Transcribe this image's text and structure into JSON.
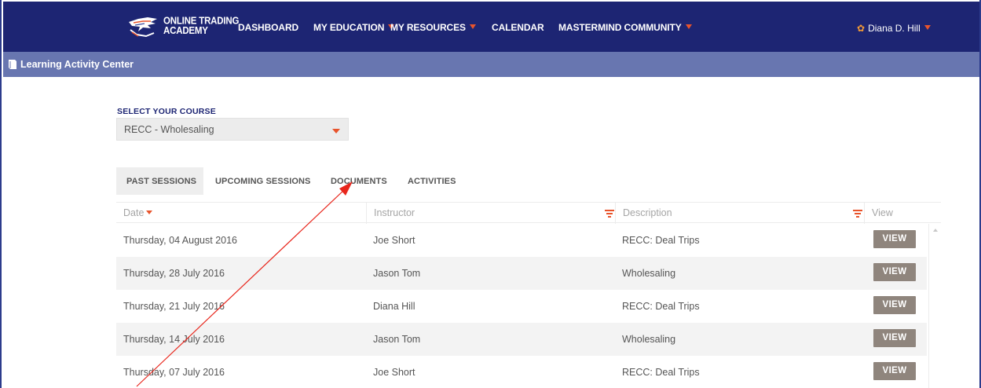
{
  "colors": {
    "nav_bg": "#1d2573",
    "subbar_bg": "#6876b0",
    "accent": "#e8542c",
    "button_bg": "#8f857d"
  },
  "logo": {
    "line1": "ONLINE TRADING",
    "line2": "ACADEMY"
  },
  "nav": {
    "items": [
      {
        "label": "DASHBOARD",
        "has_dropdown": false
      },
      {
        "label": "MY EDUCATION",
        "has_dropdown": true
      },
      {
        "label": "MY RESOURCES",
        "has_dropdown": true
      },
      {
        "label": "CALENDAR",
        "has_dropdown": false
      },
      {
        "label": "MASTERMIND COMMUNITY",
        "has_dropdown": true
      }
    ],
    "user_name": "Diana D. Hill"
  },
  "subheader": {
    "title": "Learning Activity Center",
    "icon": "book-icon"
  },
  "course": {
    "label": "SELECT YOUR COURSE",
    "selected": "RECC - Wholesaling"
  },
  "tabs": [
    {
      "label": "PAST SESSIONS",
      "active": true
    },
    {
      "label": "UPCOMING SESSIONS",
      "active": false
    },
    {
      "label": "DOCUMENTS",
      "active": false
    },
    {
      "label": "ACTIVITIES",
      "active": false
    }
  ],
  "table": {
    "columns": [
      "Date",
      "Instructor",
      "Description",
      "View"
    ],
    "rows": [
      {
        "date": "Thursday, 04 August 2016",
        "instructor": "Joe Short",
        "description": "RECC: Deal Trips",
        "action": "VIEW"
      },
      {
        "date": "Thursday, 28 July 2016",
        "instructor": "Jason Tom",
        "description": "Wholesaling",
        "action": "VIEW"
      },
      {
        "date": "Thursday, 21 July 2016",
        "instructor": "Diana Hill",
        "description": "RECC: Deal Trips",
        "action": "VIEW"
      },
      {
        "date": "Thursday, 14 July 2016",
        "instructor": "Jason Tom",
        "description": "Wholesaling",
        "action": "VIEW"
      },
      {
        "date": "Thursday, 07 July 2016",
        "instructor": "Joe Short",
        "description": "RECC: Deal Trips",
        "action": "VIEW"
      }
    ]
  }
}
